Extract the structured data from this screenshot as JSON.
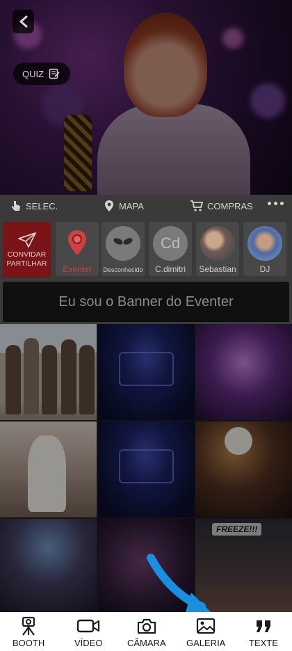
{
  "hero": {
    "quiz_label": "QUIZ"
  },
  "menu": {
    "select_label": "SELEC.",
    "map_label": "MAPA",
    "shop_label": "COMPRAS"
  },
  "stories": {
    "invite_line1": "CONVIDAR",
    "invite_line2": "PARTILHAR",
    "items": [
      {
        "label": "Eventer"
      },
      {
        "label": "Desconhecido"
      },
      {
        "label": "C.dimitri",
        "initials": "Cd"
      },
      {
        "label": "Sebastian"
      },
      {
        "label": "DJ"
      }
    ]
  },
  "banner": {
    "text": "Eu sou o Banner do Eventer"
  },
  "gallery": {
    "freeze_tag": "FREEZE!!!"
  },
  "bottom_nav": {
    "booth": "BOOTH",
    "video": "VÍDEO",
    "camera": "CÂMARA",
    "gallery": "GALERIA",
    "texte": "TEXTE"
  },
  "colors": {
    "invite_bg": "#7b1418",
    "eventer_red": "#d04040",
    "arrow_blue": "#1a8fe0"
  }
}
